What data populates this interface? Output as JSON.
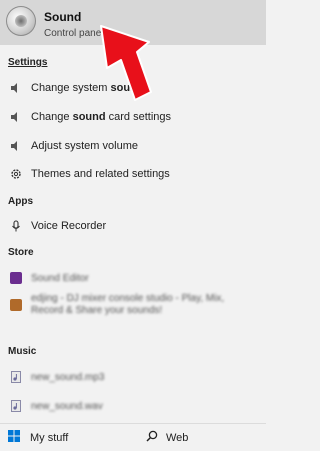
{
  "top_result": {
    "title": "Sound",
    "subtitle": "Control panel"
  },
  "sections": {
    "settings": "Settings",
    "apps": "Apps",
    "store": "Store",
    "music": "Music"
  },
  "settings_items": [
    {
      "pre": "Change system ",
      "bold": "sound",
      "post": "",
      "icon": "speaker-icon"
    },
    {
      "pre": "Change ",
      "bold": "sound",
      "post": " card settings",
      "icon": "speaker-icon"
    },
    {
      "pre": "Adjust system volume",
      "bold": "",
      "post": "",
      "icon": "speaker-icon"
    },
    {
      "pre": "Themes and related settings",
      "bold": "",
      "post": "",
      "icon": "gear-icon"
    }
  ],
  "apps_items": [
    {
      "label": "Voice Recorder",
      "icon": "microphone-icon"
    }
  ],
  "store_items": [
    {
      "label": "Sound Editor",
      "icon": "app-tile-icon",
      "color": "#6b2e8f"
    },
    {
      "label": "edjing - DJ mixer console studio - Play, Mix, Record & Share your sounds!",
      "icon": "app-tile-icon",
      "color": "#b06a2a"
    }
  ],
  "music_items": [
    {
      "label": "new_sound.mp3",
      "icon": "music-file-icon"
    },
    {
      "label": "new_sound.wav",
      "icon": "music-file-icon"
    }
  ],
  "bottom": {
    "my_stuff": "My stuff",
    "web": "Web"
  },
  "colors": {
    "top_bg": "#d7d7d7",
    "arrow": "#e8101a"
  }
}
